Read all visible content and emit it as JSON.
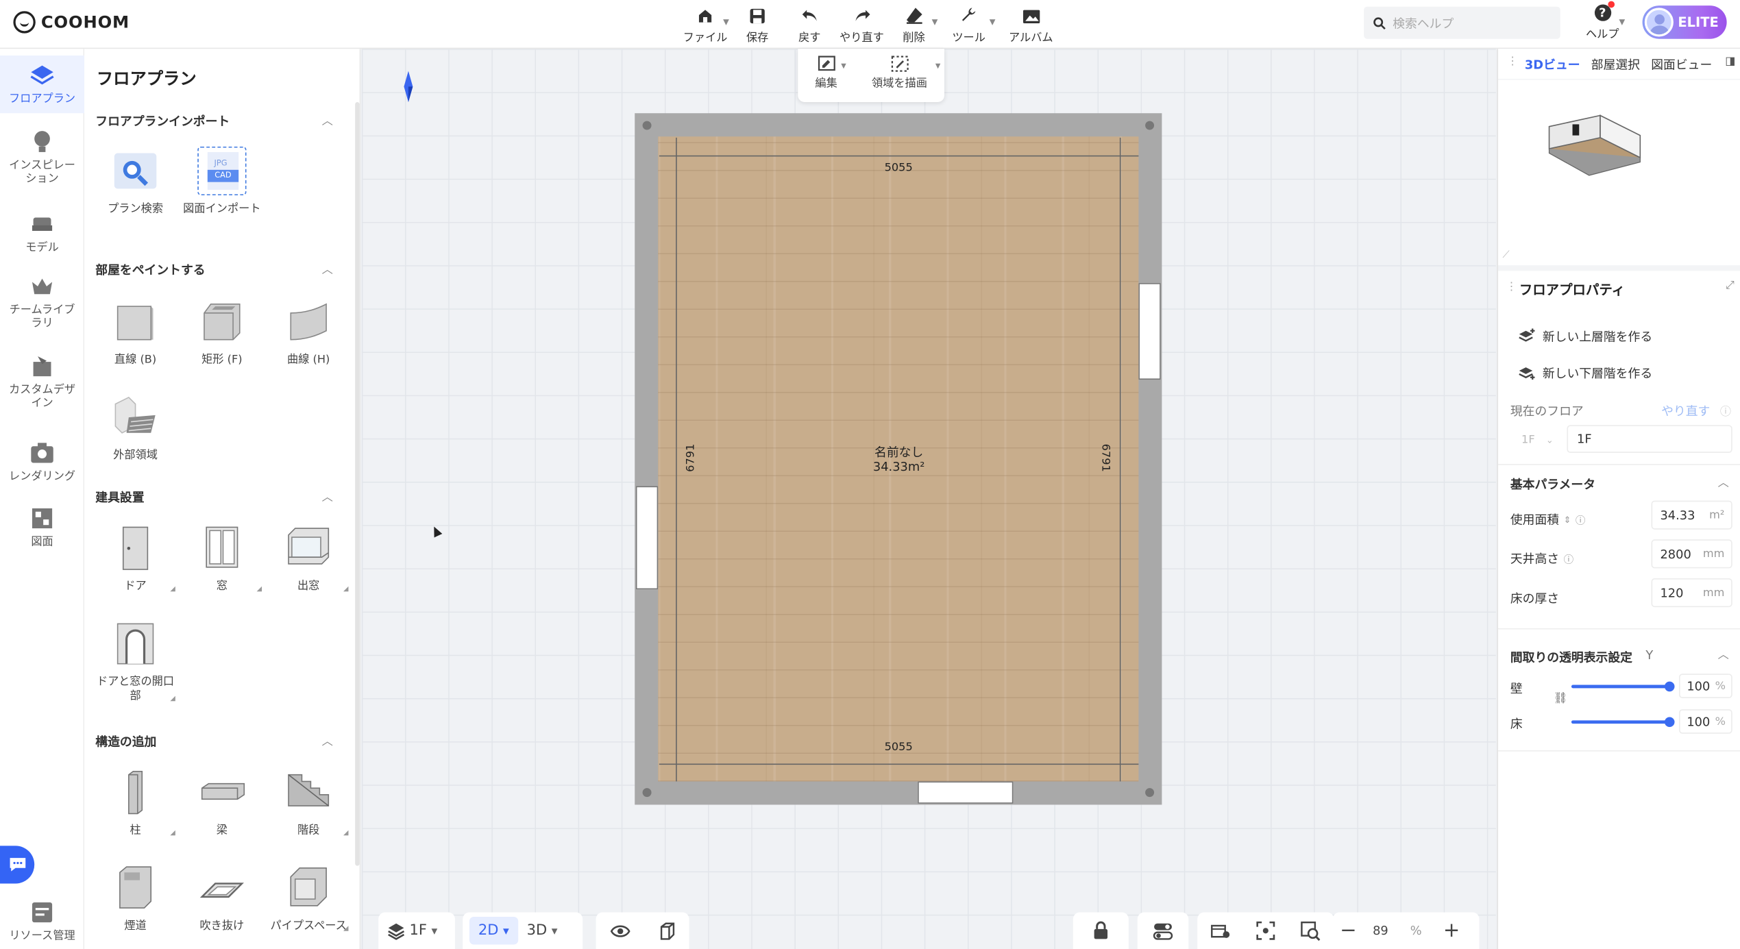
{
  "app": {
    "logo_text": "COOHOM"
  },
  "toolbar": {
    "items": [
      {
        "label": "ファイル",
        "icon": "home-file-icon",
        "has_menu": true
      },
      {
        "label": "保存",
        "icon": "save-icon",
        "has_menu": false
      },
      {
        "label": "戻す",
        "icon": "undo-icon",
        "has_menu": false
      },
      {
        "label": "やり直す",
        "icon": "redo-icon",
        "has_menu": false
      },
      {
        "label": "削除",
        "icon": "eraser-icon",
        "has_menu": true
      },
      {
        "label": "ツール",
        "icon": "wrench-icon",
        "has_menu": true
      },
      {
        "label": "アルバム",
        "icon": "album-icon",
        "has_menu": false
      }
    ]
  },
  "search": {
    "placeholder": "検索ヘルプ"
  },
  "help": {
    "label": "ヘルプ"
  },
  "account": {
    "badge": "ELITE"
  },
  "rail": {
    "items": [
      {
        "label": "フロアプラン",
        "active": true
      },
      {
        "label": "インスピレーション"
      },
      {
        "label": "モデル"
      },
      {
        "label": "チームライブラリ"
      },
      {
        "label": "カスタムデザイン"
      },
      {
        "label": "レンダリング"
      },
      {
        "label": "図面"
      },
      {
        "label": "リソース管理"
      }
    ]
  },
  "left_panel": {
    "title": "フロアプラン",
    "sections": [
      {
        "title": "フロアプランインポート",
        "items": [
          "プラン検索",
          "図面インポート"
        ]
      },
      {
        "title": "部屋をペイントする",
        "items": [
          "直線 (B)",
          "矩形 (F)",
          "曲線 (H)",
          "外部領域"
        ]
      },
      {
        "title": "建具設置",
        "items": [
          "ドア",
          "窓",
          "出窓",
          "ドアと窓の開口部"
        ]
      },
      {
        "title": "構造の追加",
        "items": [
          "柱",
          "梁",
          "階段",
          "煙道",
          "吹き抜け",
          "パイプスペース"
        ]
      }
    ],
    "import_badges": {
      "jpg": "JPG",
      "cad": "CAD"
    }
  },
  "subbar": {
    "edit": "編集",
    "draw_area": "領域を描画"
  },
  "room": {
    "name": "名前なし",
    "area": "34.33m²",
    "dim_top": "5055",
    "dim_bottom": "5055",
    "dim_left": "6791",
    "dim_right": "6791"
  },
  "bottom": {
    "floor": "1F",
    "mode_2d": "2D",
    "mode_3d": "3D",
    "zoom": "89",
    "zoom_unit": "%"
  },
  "right_panel": {
    "tabs": [
      "3Dビュー",
      "部屋選択",
      "図面ビュー"
    ],
    "active_tab": "3Dビュー",
    "title": "フロアプロパティ",
    "new_upper": "新しい上層階を作る",
    "new_lower": "新しい下層階を作る",
    "current_floor_label": "現在のフロア",
    "redo_label": "やり直す",
    "floor_small": "1F",
    "floor_name": "1F",
    "basic_params": "基本パラメータ",
    "params": [
      {
        "label": "使用面積",
        "value": "34.33",
        "unit": "m²"
      },
      {
        "label": "天井高さ",
        "value": "2800",
        "unit": "mm"
      },
      {
        "label": "床の厚さ",
        "value": "120",
        "unit": "mm"
      }
    ],
    "transparency_title": "間取りの透明表示設定",
    "transparency_key": "Y",
    "transparency": [
      {
        "label": "壁",
        "value": "100",
        "unit": "%"
      },
      {
        "label": "床",
        "value": "100",
        "unit": "%"
      }
    ]
  },
  "colors": {
    "accent": "#3a66f0",
    "wall": "#a9a9a9",
    "floor": "#c8ad8c"
  }
}
